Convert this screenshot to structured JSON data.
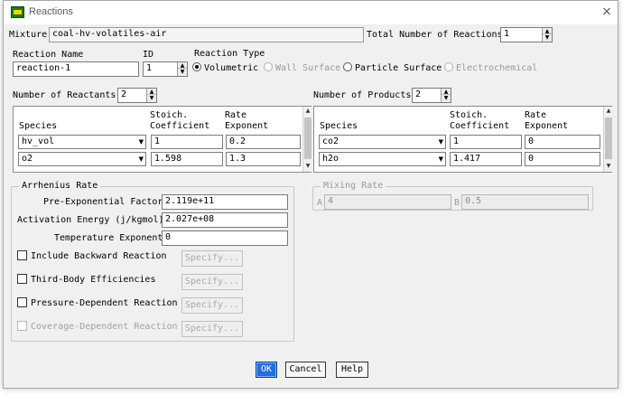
{
  "window": {
    "title": "Reactions",
    "close_glyph": "×"
  },
  "mixture": {
    "label": "Mixture",
    "value": "coal-hv-volatiles-air"
  },
  "total_reactions": {
    "label": "Total Number of Reactions",
    "value": "1"
  },
  "reaction_name": {
    "label": "Reaction Name",
    "value": "reaction-1"
  },
  "reaction_id": {
    "label": "ID",
    "value": "1"
  },
  "reaction_type": {
    "title": "Reaction Type",
    "options": [
      "Volumetric",
      "Wall Surface",
      "Particle Surface",
      "Electrochemical"
    ],
    "selected": "Volumetric"
  },
  "reactants": {
    "count_label": "Number of Reactants",
    "count": "2",
    "headers": {
      "species": "Species",
      "stoich_1": "Stoich.",
      "stoich_2": "Coefficient",
      "rate_1": "Rate",
      "rate_2": "Exponent"
    },
    "rows": [
      {
        "species": "hv_vol",
        "stoich": "1",
        "rate": "0.2"
      },
      {
        "species": "o2",
        "stoich": "1.598",
        "rate": "1.3"
      }
    ]
  },
  "products": {
    "count_label": "Number of Products",
    "count": "2",
    "headers": {
      "species": "Species",
      "stoich_1": "Stoich.",
      "stoich_2": "Coefficient",
      "rate_1": "Rate",
      "rate_2": "Exponent"
    },
    "rows": [
      {
        "species": "co2",
        "stoich": "1",
        "rate": "0"
      },
      {
        "species": "h2o",
        "stoich": "1.417",
        "rate": "0"
      }
    ]
  },
  "arrhenius": {
    "title": "Arrhenius Rate",
    "pre_exp_label": "Pre-Exponential Factor",
    "pre_exp_value": "2.119e+11",
    "activation_label": "Activation Energy (j/kgmol)",
    "activation_value": "2.027e+08",
    "temp_label": "Temperature Exponent",
    "temp_value": "0",
    "options": [
      {
        "label": "Include Backward Reaction",
        "button": "Specify..."
      },
      {
        "label": "Third-Body Efficiencies",
        "button": "Specify..."
      },
      {
        "label": "Pressure-Dependent Reaction",
        "button": "Specify..."
      },
      {
        "label": "Coverage-Dependent Reaction",
        "button": "Specify..."
      }
    ]
  },
  "mixing_rate": {
    "title": "Mixing Rate",
    "a_label": "A",
    "a_value": "4",
    "b_label": "B",
    "b_value": "0.5"
  },
  "buttons": {
    "ok": "OK",
    "cancel": "Cancel",
    "help": "Help"
  },
  "icons": {
    "app": "fluent-app-icon",
    "dropdown": "chevron-down-icon",
    "spin": "spin-arrows-icon",
    "close": "close-icon"
  },
  "colors": {
    "ok_button": "#1e6fe0",
    "window_bg": "#f0f0f0"
  }
}
